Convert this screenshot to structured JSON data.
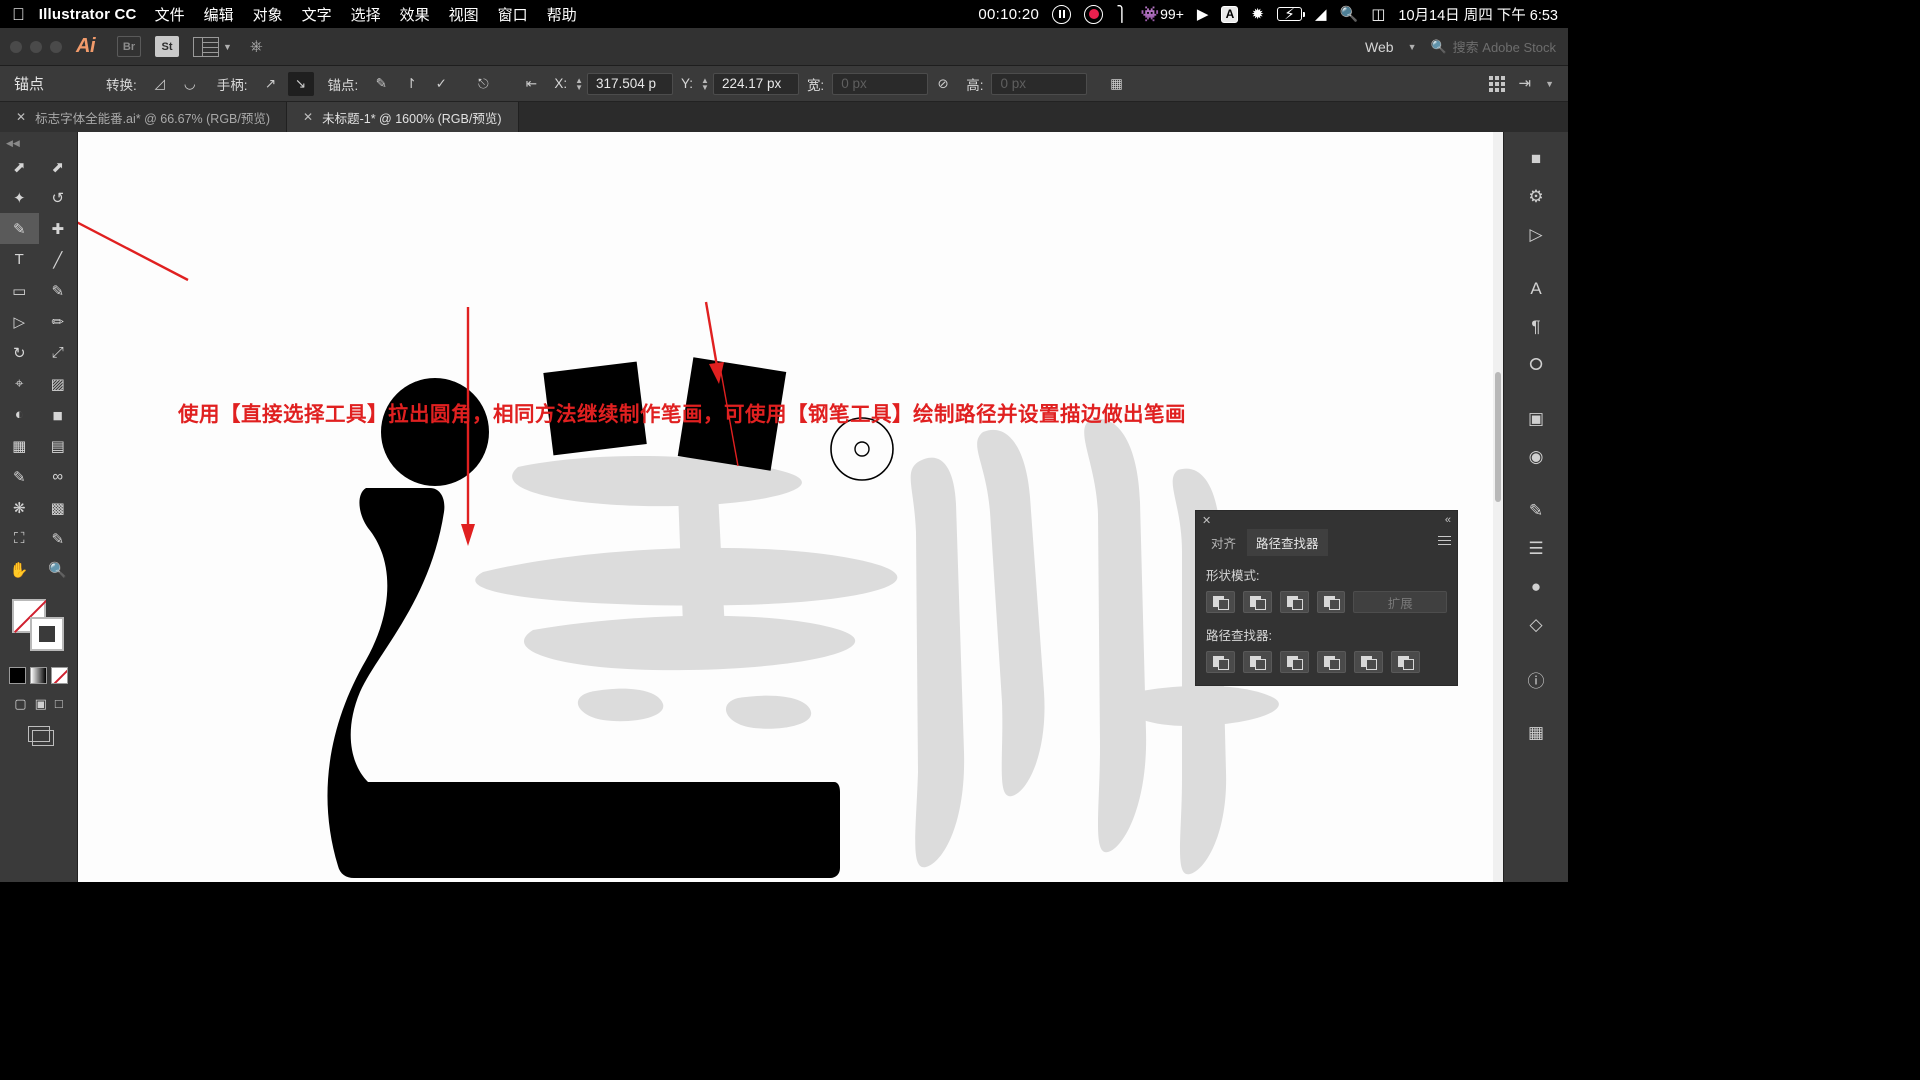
{
  "menubar": {
    "apple_icon": "apple-icon",
    "app_name": "Illustrator CC",
    "menus": [
      "文件",
      "编辑",
      "对象",
      "文字",
      "选择",
      "效果",
      "视图",
      "窗口",
      "帮助"
    ],
    "timer": "00:10:20",
    "pause_icon": "pause-icon",
    "record_icon": "record-icon",
    "flag_icon": "flag-icon",
    "notification_count": "99+",
    "play_icon": "play-circle-icon",
    "input_source": "A",
    "bluetooth_icon": "bluetooth-icon",
    "battery_icon": "battery-charging-icon",
    "wifi_icon": "wifi-icon",
    "spotlight_icon": "search-icon",
    "controlcenter_icon": "control-center-icon",
    "datetime": "10月14日 周四 下午 6:53"
  },
  "appbar": {
    "ai_logo": "Ai",
    "bridge_label": "Br",
    "stock_label": "St",
    "arrange_icon": "arrange-documents-icon",
    "chevron_icon": "chevron-down-icon",
    "home_icon": "home-icon",
    "workspace": "Web",
    "workspace_chevron": "chevron-down-icon",
    "search_icon": "search-icon",
    "search_placeholder": "搜索 Adobe Stock"
  },
  "controlbar": {
    "title": "锚点",
    "convert_label": "转换:",
    "convert_corner_icon": "convert-to-corner-icon",
    "convert_smooth_icon": "convert-to-smooth-icon",
    "handles_label": "手柄:",
    "handle_show_icon": "show-handles-icon",
    "handle_hide_icon": "hide-handles-icon",
    "anchors_label": "锚点:",
    "anchor_remove_icon": "remove-anchor-icon",
    "anchor_connect_icon": "connect-anchor-icon",
    "anchor_cut_icon": "cut-path-icon",
    "align_icon": "align-objects-icon",
    "isolate_icon": "isolate-selected-icon",
    "transform_icon": "transform-icon",
    "x_label": "X:",
    "x_value": "317.504 p",
    "y_label": "Y:",
    "y_value": "224.17 px",
    "w_label": "宽:",
    "w_value": "0 px",
    "lock_icon": "unlink-proportions-icon",
    "h_label": "高:",
    "h_value": "0 px",
    "anchor_grid_icon": "reference-point-icon",
    "workspace_grid_icon": "arrange-grid-icon",
    "panel_toggle_icon": "panel-toggle-icon",
    "overflow_icon": "chevron-down-icon"
  },
  "tabs": [
    {
      "close_icon": "close-icon",
      "label": "标志字体全能番.ai* @ 66.67% (RGB/预览)",
      "active": false
    },
    {
      "close_icon": "close-icon",
      "label": "未标题-1* @ 1600% (RGB/预览)",
      "active": true
    }
  ],
  "toolbar": {
    "grip_icon": "panel-grip-icon",
    "tools": [
      {
        "name": "selection-tool",
        "glyph": "⬉"
      },
      {
        "name": "direct-selection-tool",
        "glyph": "⬈"
      },
      {
        "name": "magic-wand-tool",
        "glyph": "✦"
      },
      {
        "name": "lasso-tool",
        "glyph": "◠"
      },
      {
        "name": "pen-tool",
        "glyph": "✒"
      },
      {
        "name": "add-anchor-point-tool",
        "glyph": "✎"
      },
      {
        "name": "type-tool",
        "glyph": "T"
      },
      {
        "name": "line-segment-tool",
        "glyph": "╱"
      },
      {
        "name": "rectangle-tool",
        "glyph": "▭"
      },
      {
        "name": "paintbrush-tool",
        "glyph": "🖌"
      },
      {
        "name": "shaper-tool",
        "glyph": "▷"
      },
      {
        "name": "pencil-tool",
        "glyph": "✐"
      },
      {
        "name": "rotate-tool",
        "glyph": "↻"
      },
      {
        "name": "scale-tool",
        "glyph": "⤢"
      },
      {
        "name": "width-tool",
        "glyph": "≶"
      },
      {
        "name": "free-transform-tool",
        "glyph": "⌗"
      },
      {
        "name": "shape-builder-tool",
        "glyph": "◓"
      },
      {
        "name": "perspective-grid-tool",
        "glyph": "◺"
      },
      {
        "name": "mesh-tool",
        "glyph": "▦"
      },
      {
        "name": "gradient-tool",
        "glyph": "▥"
      },
      {
        "name": "eyedropper-tool",
        "glyph": "✐"
      },
      {
        "name": "blend-tool",
        "glyph": "∞"
      },
      {
        "name": "symbol-sprayer-tool",
        "glyph": "❋"
      },
      {
        "name": "column-graph-tool",
        "glyph": "▤"
      },
      {
        "name": "artboard-tool",
        "glyph": "⊞"
      },
      {
        "name": "slice-tool",
        "glyph": "✂"
      },
      {
        "name": "hand-tool",
        "glyph": "✋"
      },
      {
        "name": "zoom-tool",
        "glyph": "🔍"
      }
    ],
    "fill_swatch_name": "fill-swatch",
    "stroke_swatch_name": "stroke-swatch",
    "color_black": "#000000",
    "color_none": "#ffffff",
    "none_stroke_color": "#d0202f"
  },
  "annotation": {
    "text": "使用【直接选择工具】拉出圆角，相同方法继续制作笔画，可使用【钢笔工具】绘制路径并设置描边做出笔画",
    "color": "#e02020",
    "arrow_count": 3
  },
  "pathfinder_panel": {
    "close_icon": "close-icon",
    "collapse_icon": "collapse-panel-icon",
    "menu_icon": "panel-menu-icon",
    "tabs": [
      {
        "label": "对齐",
        "active": false
      },
      {
        "label": "路径查找器",
        "active": true
      }
    ],
    "shape_modes_label": "形状模式:",
    "shape_mode_buttons": [
      "unite-icon",
      "minus-front-icon",
      "intersect-icon",
      "exclude-icon"
    ],
    "expand_label": "扩展",
    "pathfinders_label": "路径查找器:",
    "pathfinder_buttons": [
      "divide-icon",
      "trim-icon",
      "merge-icon",
      "crop-icon",
      "outline-icon",
      "minus-back-icon"
    ]
  },
  "right_dock": {
    "items": [
      "color-panel-icon",
      "color-guide-icon",
      "libraries-icon",
      "character-panel-icon",
      "paragraph-panel-icon",
      "opacity-panel-icon",
      "transform-panel-icon",
      "symbols-panel-icon",
      "brushes-panel-icon",
      "layers-panel-icon",
      "appearance-panel-icon",
      "graphic-styles-icon",
      "info-panel-icon",
      "artboards-panel-icon"
    ]
  },
  "canvas": {
    "zoom_percent": "1600%",
    "scrollbar_name": "vertical-scrollbar"
  }
}
